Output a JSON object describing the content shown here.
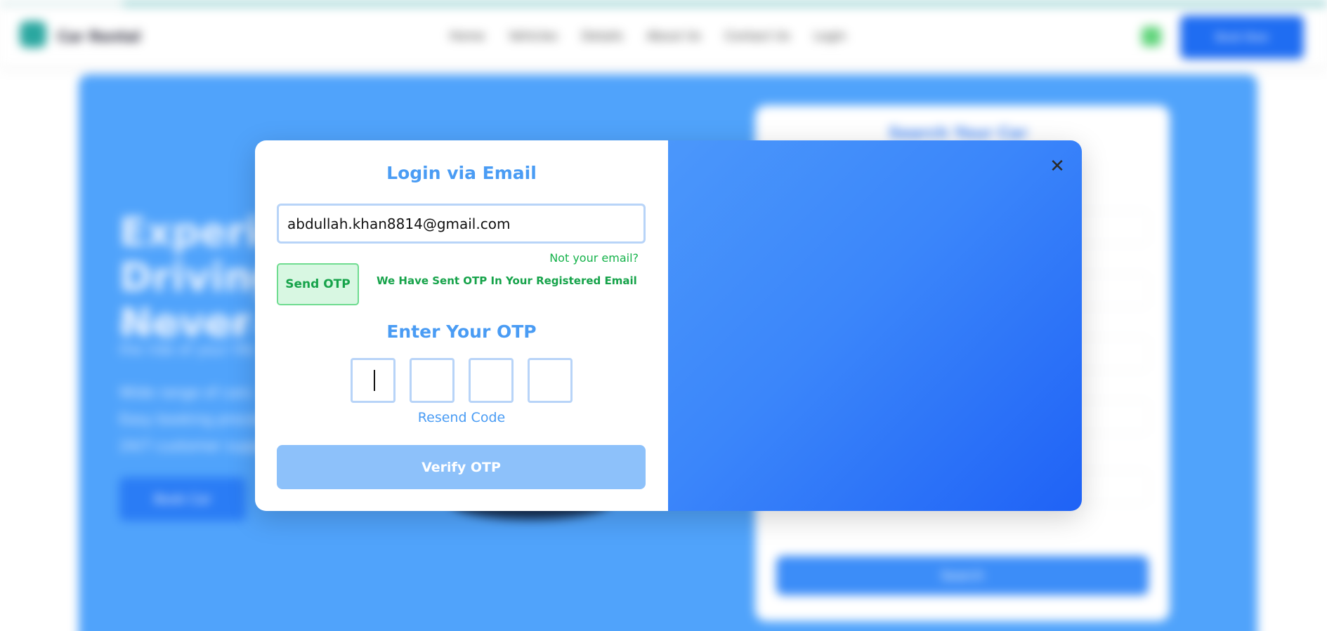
{
  "background": {
    "brand": "Car Rental",
    "nav_links": [
      "Home",
      "Vehicles",
      "Details",
      "About Us",
      "Contact Us",
      "Login"
    ],
    "nav_cta": "Book Now",
    "hero_title": "Experience Driving Like Never Before",
    "hero_subtitle": "Book your favorite car with ease and enjoy the ride of your life",
    "hero_points": [
      "Wide range of cars",
      "Easy booking process",
      "24/7 customer support"
    ],
    "hero_button": "Book Car",
    "side_card_title": "Search Your Car",
    "side_card_button": "Search"
  },
  "modal": {
    "title": "Login via Email",
    "email_value": "abdullah.khan8814@gmail.com",
    "not_your_email": "Not your email?",
    "send_otp_label": "Send OTP",
    "otp_sent_message": "We Have Sent OTP In Your Registered Email",
    "otp_title": "Enter Your OTP",
    "otp_digits": [
      "",
      "",
      "",
      ""
    ],
    "resend_label": "Resend Code",
    "verify_label": "Verify OTP",
    "close_icon": "close-icon",
    "colors": {
      "accent": "#4a9cf4",
      "success": "#16a34a",
      "panel_gradient_start": "#4b97fb",
      "panel_gradient_end": "#1f62f6"
    }
  }
}
